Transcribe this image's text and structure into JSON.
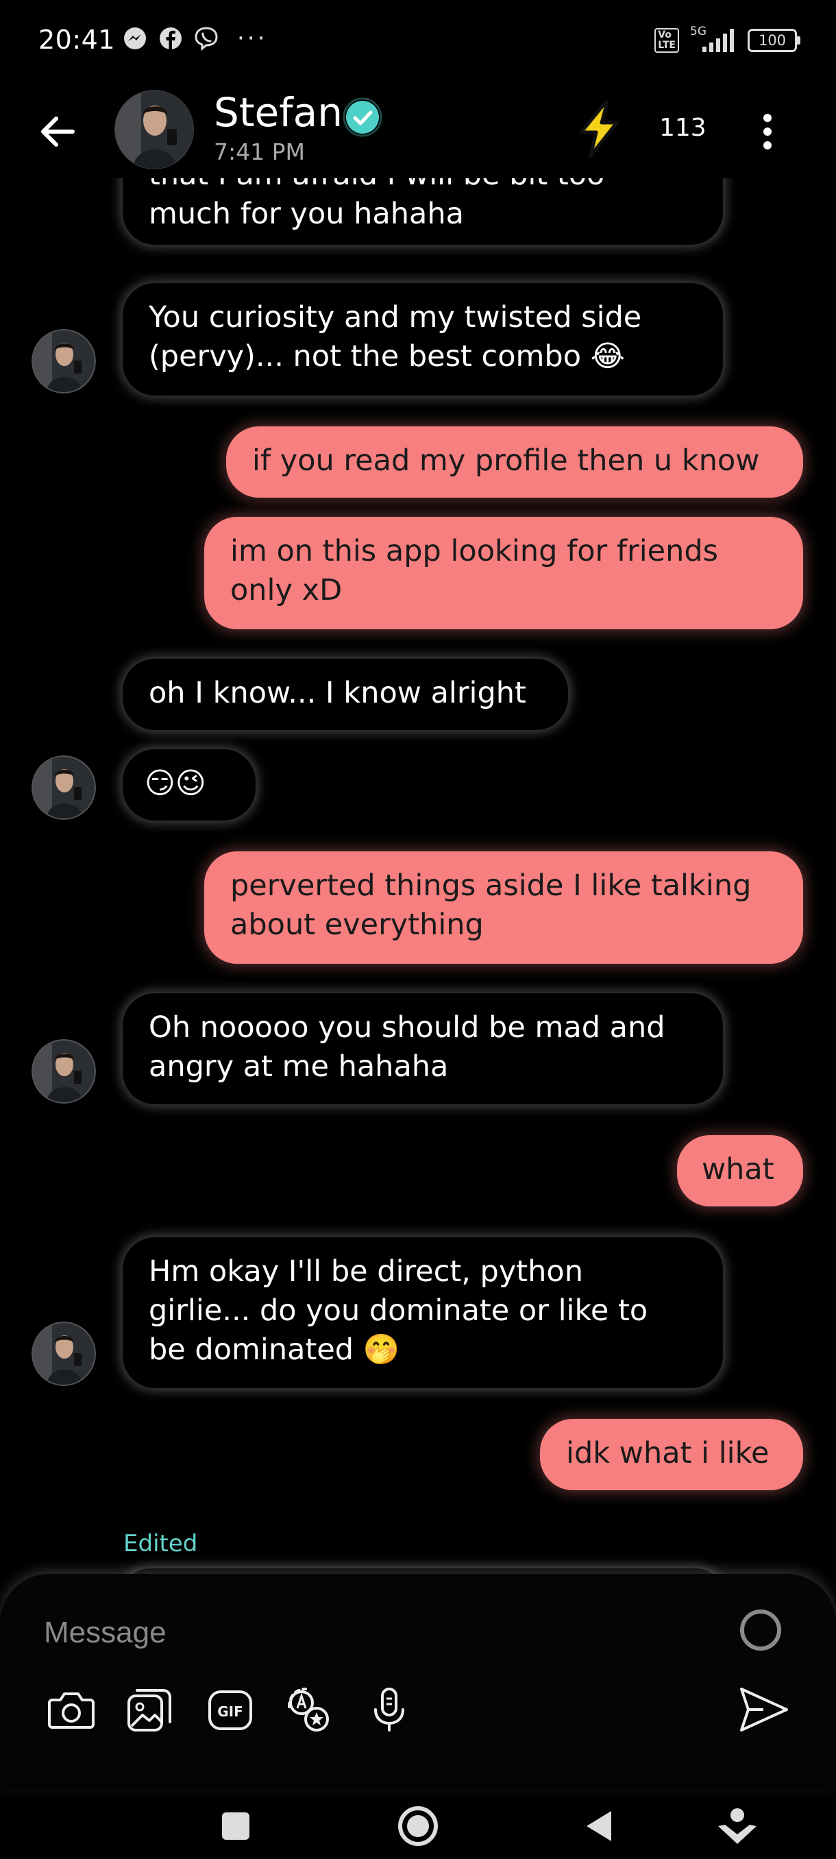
{
  "status_bar": {
    "time": "20:41",
    "network_label": "5G",
    "volte_label": "Vo\nLTE",
    "battery": "100",
    "overflow_dots": "···"
  },
  "header": {
    "contact_name": "Stefan",
    "last_seen": "7:41 PM",
    "points": "113"
  },
  "messages": [
    {
      "side": "received",
      "text": "that I am afraid I will be bit too\nmuch for you hahaha"
    },
    {
      "side": "received",
      "text": "You curiosity and my twisted side\n(pervy)... not the best combo 😂"
    },
    {
      "side": "sent",
      "text": "if you read my profile then u know"
    },
    {
      "side": "sent",
      "text": "im on this app looking for friends\nonly xD"
    },
    {
      "side": "received",
      "text": "oh I know... I know alright"
    },
    {
      "side": "received",
      "text": "😏😉"
    },
    {
      "side": "sent",
      "text": "perverted things aside I like talking\nabout everything"
    },
    {
      "side": "received",
      "text": "Oh nooooo you should be mad and\nangry at me hahaha"
    },
    {
      "side": "sent",
      "text": "what"
    },
    {
      "side": "received",
      "text": "Hm okay I'll be direct, python\ngirlie... do you dominate or like to\nbe dominated 🤭"
    },
    {
      "side": "sent",
      "text": "idk what i like"
    }
  ],
  "edited_label": "Edited",
  "composer": {
    "placeholder": "Message",
    "gif_label": "GIF"
  },
  "colors": {
    "sent_bubble": "#f77f7f",
    "verified": "#4dd0c8",
    "edited": "#62d4cc",
    "bolt": "#f5d21a"
  }
}
